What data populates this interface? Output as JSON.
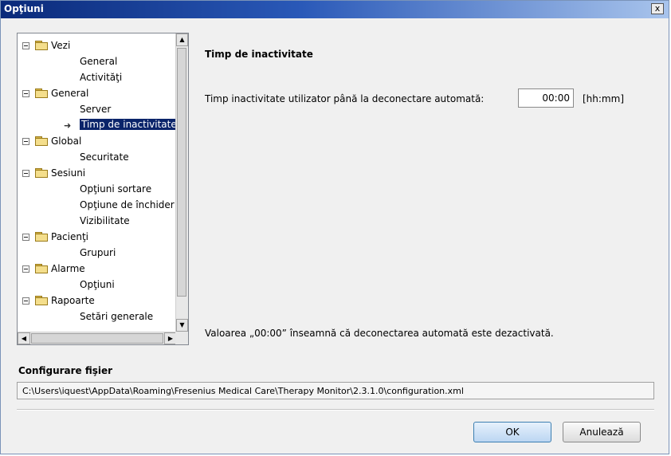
{
  "window": {
    "title": "Opţiuni",
    "close_glyph": "x"
  },
  "tree": {
    "nodes": [
      {
        "label": "Vezi",
        "level": 0,
        "expanded": true
      },
      {
        "label": "General",
        "level": 1
      },
      {
        "label": "Activităţi",
        "level": 1
      },
      {
        "label": "General",
        "level": 0,
        "expanded": true
      },
      {
        "label": "Server",
        "level": 1
      },
      {
        "label": "Timp de inactivitate",
        "level": 1,
        "selected": true
      },
      {
        "label": "Global",
        "level": 0,
        "expanded": true
      },
      {
        "label": "Securitate",
        "level": 1
      },
      {
        "label": "Sesiuni",
        "level": 0,
        "expanded": true
      },
      {
        "label": "Opţiuni sortare",
        "level": 1
      },
      {
        "label": "Opţiune de închider",
        "level": 1
      },
      {
        "label": "Vizibilitate",
        "level": 1
      },
      {
        "label": "Pacienţi",
        "level": 0,
        "expanded": true
      },
      {
        "label": "Grupuri",
        "level": 1
      },
      {
        "label": "Alarme",
        "level": 0,
        "expanded": true
      },
      {
        "label": "Opţiuni",
        "level": 1
      },
      {
        "label": "Rapoarte",
        "level": 0,
        "expanded": true
      },
      {
        "label": "Setări generale",
        "level": 1
      }
    ]
  },
  "panel": {
    "heading": "Timp de inactivitate",
    "field_label": "Timp inactivitate utilizator până la deconectare automată:",
    "field_value": "00:00",
    "unit": "[hh:mm]",
    "note": "Valoarea „00:00” înseamnă că deconectarea automată este dezactivată."
  },
  "config": {
    "title": "Configurare fişier",
    "path": "C:\\Users\\iquest\\AppData\\Roaming\\Fresenius Medical Care\\Therapy Monitor\\2.3.1.0\\configuration.xml"
  },
  "buttons": {
    "ok": "OK",
    "cancel": "Anulează"
  },
  "colors": {
    "selection": "#0a246a",
    "titlebar": "#0a2a7a"
  }
}
